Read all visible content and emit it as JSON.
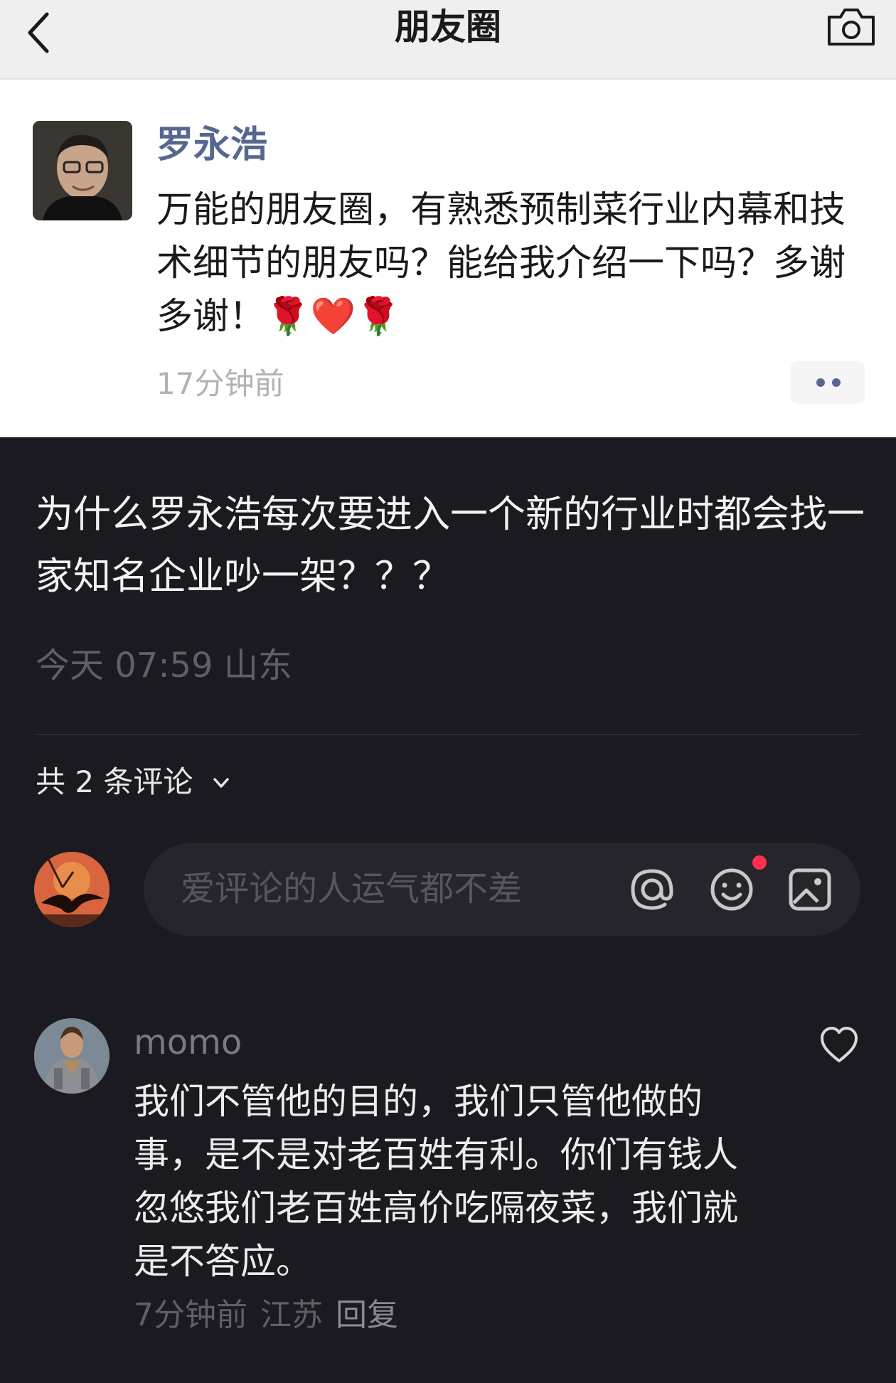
{
  "moments": {
    "title": "朋友圈",
    "poster_name": "罗永浩",
    "post_text": "万能的朋友圈，有熟悉预制菜行业内幕和技术细节的朋友吗？能给我介绍一下吗？多谢多谢！🌹❤️🌹",
    "time_ago": "17分钟前",
    "name_color": "#56688f"
  },
  "question": {
    "text": "为什么罗永浩每次要进入一个新的行业时都会找一家知名企业吵一架？？？",
    "meta": "今天 07:59 山东"
  },
  "comments_header": {
    "count_label": "共 2 条评论"
  },
  "comment_input": {
    "placeholder": "爱评论的人运气都不差"
  },
  "comment": {
    "user": "momo",
    "text": "我们不管他的目的，我们只管他做的事，是不是对老百姓有利。你们有钱人忽悠我们老百姓高价吃隔夜菜，我们就是不答应。",
    "time": "7分钟前",
    "location": "江苏",
    "reply_label": "回复"
  },
  "icons": {
    "back": "chevron-left-icon",
    "camera": "camera-icon",
    "more": "more-dots-icon",
    "expand": "chevron-down-icon",
    "mention": "at-icon",
    "emoji": "smile-icon",
    "image": "image-icon",
    "like": "heart-icon"
  },
  "colors": {
    "dark_bg": "#1b1a20",
    "notification_dot": "#ff3050"
  }
}
